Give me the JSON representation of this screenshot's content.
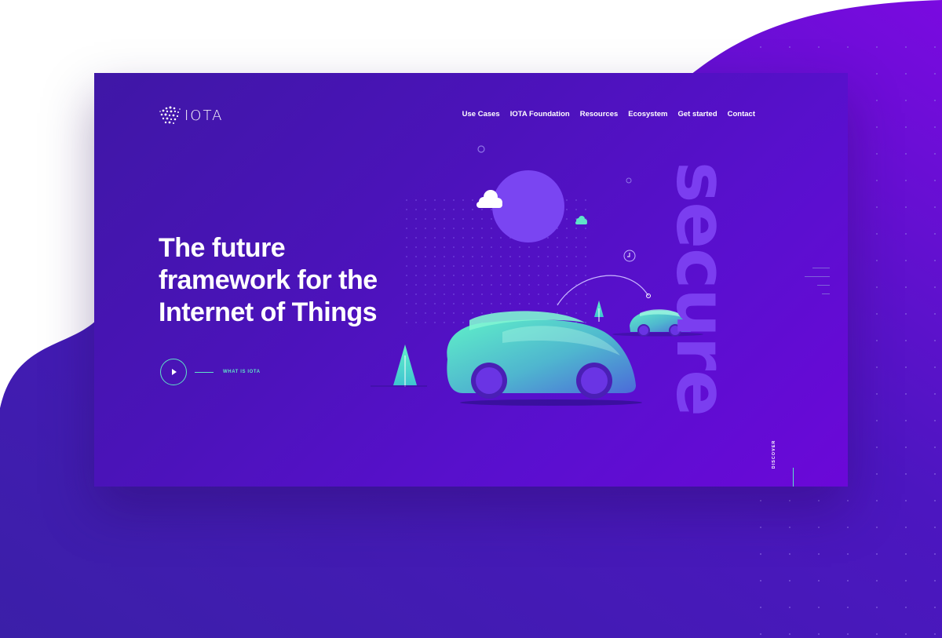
{
  "brand": {
    "name": "IOTA"
  },
  "nav": {
    "items": [
      {
        "label": "Use Cases"
      },
      {
        "label": "IOTA Foundation"
      },
      {
        "label": "Resources"
      },
      {
        "label": "Ecosystem"
      },
      {
        "label": "Get started"
      },
      {
        "label": "Contact"
      }
    ]
  },
  "hero": {
    "headline_line1": "The future",
    "headline_line2": "framework for the",
    "headline_line3": "Internet of Things",
    "cta_label": "WHAT IS IOTA",
    "side_word": "secure",
    "discover_label": "DISCOVER"
  },
  "colors": {
    "accent": "#5fe3c9",
    "hero_gradient_start": "#3f17a6",
    "hero_gradient_end": "#6b08d8",
    "side_word": "#7b3ef0",
    "sun": "#7a45f2"
  },
  "icons": [
    "iota-logo-icon",
    "play-icon",
    "cloud-icon",
    "sun-icon",
    "tree-icon",
    "car-icon",
    "clock-icon"
  ]
}
